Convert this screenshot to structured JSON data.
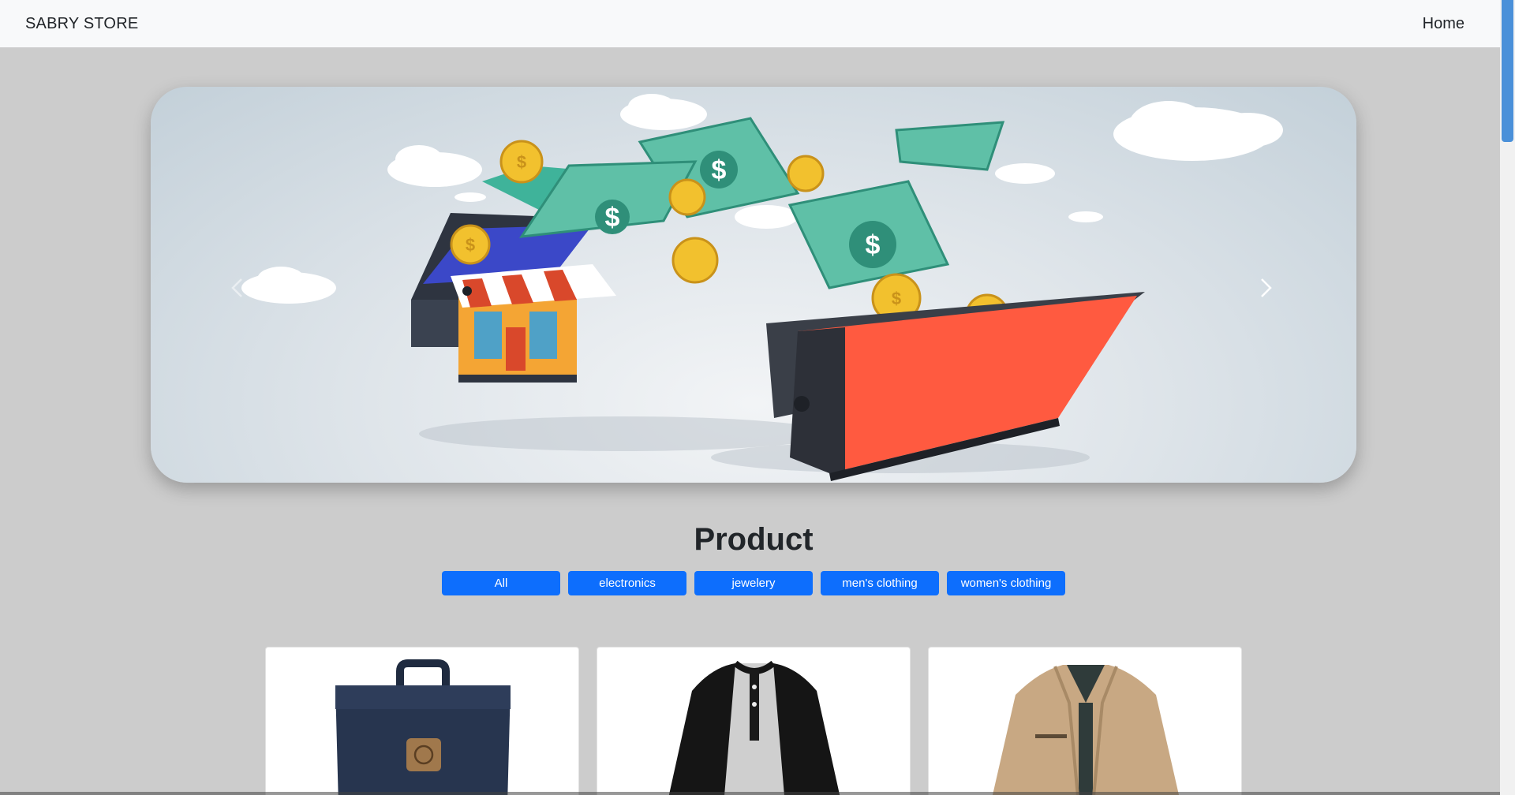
{
  "navbar": {
    "brand": "SABRY STORE",
    "home_label": "Home"
  },
  "carousel": {
    "prev_icon": "chevron-left-icon",
    "next_icon": "chevron-right-icon",
    "slide_image": "online-store-money-illustration"
  },
  "products_section": {
    "title": "Product",
    "filters": [
      "All",
      "electronics",
      "jewelery",
      "men's clothing",
      "women's clothing"
    ]
  },
  "products": [
    {
      "image": "navy-backpack-image"
    },
    {
      "image": "raglan-henley-shirt-image"
    },
    {
      "image": "beige-jacket-image"
    }
  ],
  "colors": {
    "primary": "#0d6efd",
    "background": "#cccccc",
    "navbar": "#f8f9fa"
  }
}
